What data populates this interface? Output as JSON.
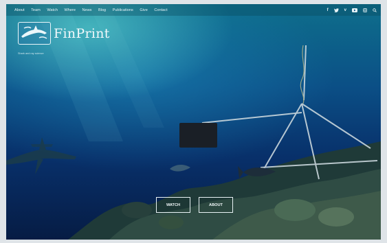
{
  "nav": {
    "items": [
      "About",
      "Team",
      "Watch",
      "Where",
      "News",
      "Blog",
      "Publications",
      "Give",
      "Contact"
    ]
  },
  "social": {
    "icons": [
      "facebook-icon",
      "twitter-icon",
      "vimeo-icon",
      "youtube-icon",
      "instagram-icon",
      "search-icon"
    ],
    "glyphs": [
      "f",
      "𝕥",
      "v",
      "▶",
      "◎",
      "⌕"
    ]
  },
  "brand": {
    "name": "FinPrint",
    "tagline": "Shark and ray science"
  },
  "hero": {
    "watch_label": "WATCH",
    "about_label": "ABOUT"
  },
  "colors": {
    "water_top": "#0e6f8c",
    "water_bottom": "#061c44",
    "text_light": "#e6f3f6"
  }
}
